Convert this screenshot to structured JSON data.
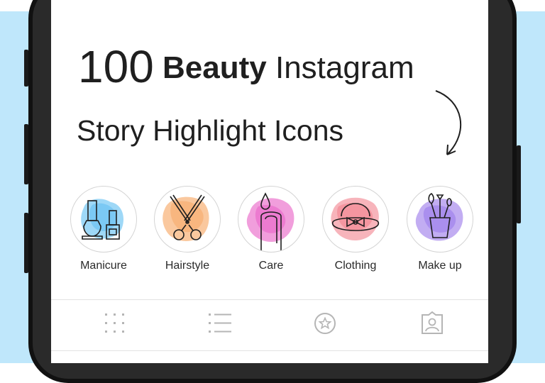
{
  "headline": {
    "number": "100",
    "bold_word": "Beauty",
    "rest": "Instagram",
    "line2": "Story Highlight Icons"
  },
  "highlights": [
    {
      "label": "Manicure",
      "icon": "nail-polish-icon",
      "color": "#4fb8f0"
    },
    {
      "label": "Hairstyle",
      "icon": "scissors-icon",
      "color": "#f59a4f"
    },
    {
      "label": "Care",
      "icon": "nail-drop-icon",
      "color": "#e64fc0"
    },
    {
      "label": "Clothing",
      "icon": "hat-bow-icon",
      "color": "#f06a78"
    },
    {
      "label": "Make up",
      "icon": "brushes-icon",
      "color": "#8f6ae8"
    }
  ],
  "bottom_nav": [
    {
      "icon": "grid-icon"
    },
    {
      "icon": "list-icon"
    },
    {
      "icon": "star-circle-icon"
    },
    {
      "icon": "tagged-user-icon"
    }
  ],
  "colors": {
    "background_band": "#bfe7fb",
    "phone_frame": "#111111",
    "icon_stroke": "#1f1f1f",
    "nav_icon": "#b5b5b5"
  }
}
